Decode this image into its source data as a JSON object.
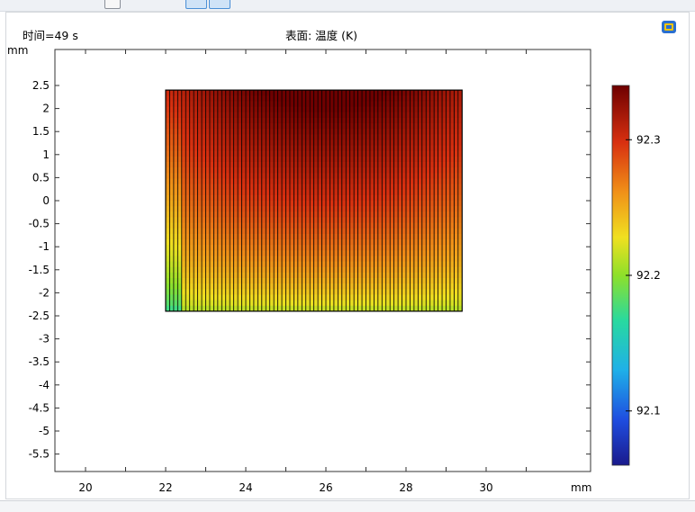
{
  "chart_data": {
    "type": "heatmap",
    "time_label": "时间=49 s",
    "title": "表面: 温度 (K)",
    "x_unit": "mm",
    "y_unit": "mm",
    "xlim": [
      17.5,
      31.5
    ],
    "ylim": [
      -6,
      3
    ],
    "x_ticks": [
      20,
      22,
      24,
      26,
      28,
      30
    ],
    "y_ticks": [
      2.5,
      2,
      1.5,
      1,
      0.5,
      0,
      -0.5,
      -1,
      -1.5,
      -2,
      -2.5,
      -3,
      -3.5,
      -4,
      -4.5,
      -5,
      -5.5
    ],
    "x_tick_labels": [
      "20",
      "22",
      "24",
      "26",
      "28",
      "30"
    ],
    "y_tick_labels": [
      "2.5",
      "2",
      "1.5",
      "1",
      "0.5",
      "0",
      "-0.5",
      "-1",
      "-1.5",
      "-2",
      "-2.5",
      "-3",
      "-3.5",
      "-4",
      "-4.5",
      "-5",
      "-5.5"
    ],
    "domain": {
      "x_min": 22,
      "x_max": 29.4,
      "y_min": -2.4,
      "y_max": 2.4
    },
    "colorbar": {
      "min": 92.06,
      "max": 92.34,
      "ticks": [
        92.3,
        92.2,
        92.1
      ],
      "tick_labels": [
        "92.3",
        "92.2",
        "92.1"
      ],
      "colormap": "rainbow"
    },
    "field": {
      "t_max": 92.34,
      "t_min_bottom": 92.2,
      "hot_x": 26
    }
  },
  "colors": {
    "toolbar_bg": "#eef1f5",
    "mesh_line": "#000000",
    "frame": "#333333"
  },
  "icons": {
    "app": "comsol-graphics-icon"
  }
}
